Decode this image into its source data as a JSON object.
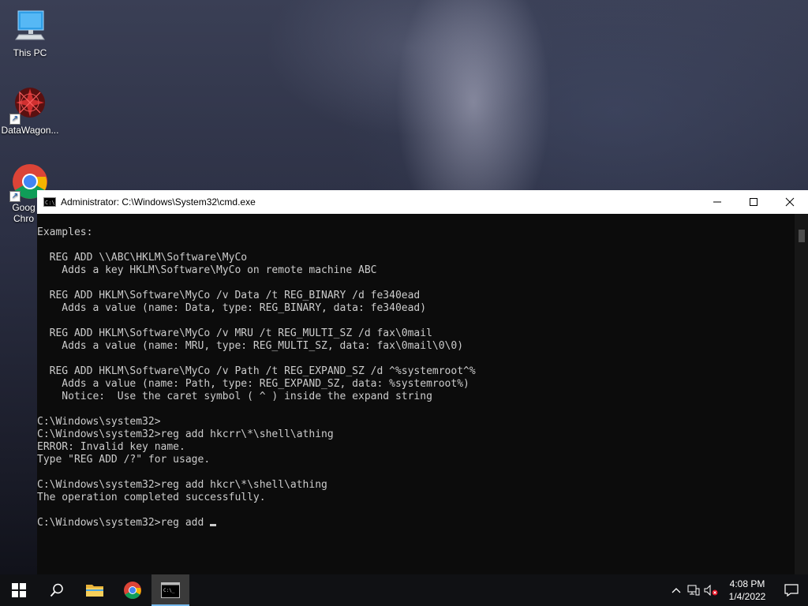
{
  "desktop": {
    "icons": [
      {
        "label": "This PC"
      },
      {
        "label": "DataWagon..."
      },
      {
        "label": "Goog Chro"
      }
    ]
  },
  "window": {
    "title": "Administrator: C:\\Windows\\System32\\cmd.exe",
    "controls": {
      "minimize": "—",
      "maximize": "☐",
      "close": "✕"
    },
    "console_text": "Examples:\n\n  REG ADD \\\\ABC\\HKLM\\Software\\MyCo\n    Adds a key HKLM\\Software\\MyCo on remote machine ABC\n\n  REG ADD HKLM\\Software\\MyCo /v Data /t REG_BINARY /d fe340ead\n    Adds a value (name: Data, type: REG_BINARY, data: fe340ead)\n\n  REG ADD HKLM\\Software\\MyCo /v MRU /t REG_MULTI_SZ /d fax\\0mail\n    Adds a value (name: MRU, type: REG_MULTI_SZ, data: fax\\0mail\\0\\0)\n\n  REG ADD HKLM\\Software\\MyCo /v Path /t REG_EXPAND_SZ /d ^%systemroot^%\n    Adds a value (name: Path, type: REG_EXPAND_SZ, data: %systemroot%)\n    Notice:  Use the caret symbol ( ^ ) inside the expand string\n\nC:\\Windows\\system32>\nC:\\Windows\\system32>reg add hkcrr\\*\\shell\\athing\nERROR: Invalid key name.\nType \"REG ADD /?\" for usage.\n\nC:\\Windows\\system32>reg add hkcr\\*\\shell\\athing\nThe operation completed successfully.\n\nC:\\Windows\\system32>reg add"
  },
  "taskbar": {
    "apps": [
      {
        "name": "start",
        "icon": "windows-logo-icon"
      },
      {
        "name": "search",
        "icon": "search-icon"
      },
      {
        "name": "file-explorer",
        "icon": "folder-icon"
      },
      {
        "name": "chrome",
        "icon": "chrome-icon"
      },
      {
        "name": "cmd",
        "icon": "cmd-icon",
        "active": true
      }
    ],
    "tray": {
      "time": "4:08 PM",
      "date": "1/4/2022"
    }
  },
  "colors": {
    "console_bg": "#0c0c0c",
    "console_fg": "#cccccc",
    "taskbar_bg": "#101114",
    "active_indicator": "#76b9ed"
  }
}
